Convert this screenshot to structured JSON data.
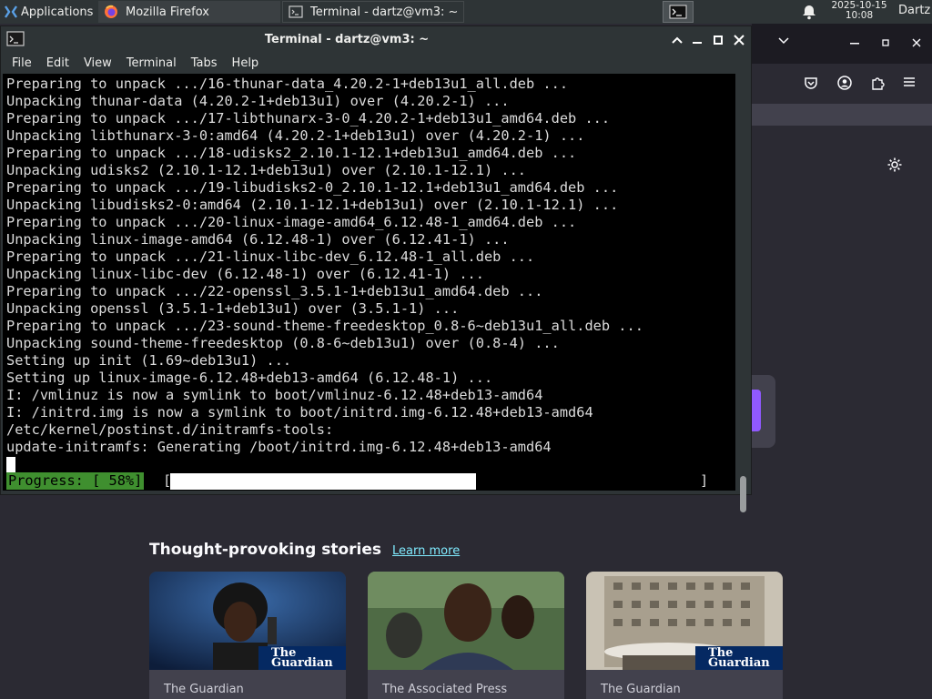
{
  "panel": {
    "applications_label": "Applications",
    "tasks": [
      {
        "title": "Mozilla Firefox"
      },
      {
        "title": "Terminal - dartz@vm3: ~"
      }
    ],
    "clock_date": "2025-10-15",
    "clock_time": "10:08",
    "user": "Dartz"
  },
  "terminal": {
    "title": "Terminal - dartz@vm3: ~",
    "menu": [
      "File",
      "Edit",
      "View",
      "Terminal",
      "Tabs",
      "Help"
    ],
    "lines": [
      "Preparing to unpack .../16-thunar-data_4.20.2-1+deb13u1_all.deb ...",
      "Unpacking thunar-data (4.20.2-1+deb13u1) over (4.20.2-1) ...",
      "Preparing to unpack .../17-libthunarx-3-0_4.20.2-1+deb13u1_amd64.deb ...",
      "Unpacking libthunarx-3-0:amd64 (4.20.2-1+deb13u1) over (4.20.2-1) ...",
      "Preparing to unpack .../18-udisks2_2.10.1-12.1+deb13u1_amd64.deb ...",
      "Unpacking udisks2 (2.10.1-12.1+deb13u1) over (2.10.1-12.1) ...",
      "Preparing to unpack .../19-libudisks2-0_2.10.1-12.1+deb13u1_amd64.deb ...",
      "Unpacking libudisks2-0:amd64 (2.10.1-12.1+deb13u1) over (2.10.1-12.1) ...",
      "Preparing to unpack .../20-linux-image-amd64_6.12.48-1_amd64.deb ...",
      "Unpacking linux-image-amd64 (6.12.48-1) over (6.12.41-1) ...",
      "Preparing to unpack .../21-linux-libc-dev_6.12.48-1_all.deb ...",
      "Unpacking linux-libc-dev (6.12.48-1) over (6.12.41-1) ...",
      "Preparing to unpack .../22-openssl_3.5.1-1+deb13u1_amd64.deb ...",
      "Unpacking openssl (3.5.1-1+deb13u1) over (3.5.1-1) ...",
      "Preparing to unpack .../23-sound-theme-freedesktop_0.8-6~deb13u1_all.deb ...",
      "Unpacking sound-theme-freedesktop (0.8-6~deb13u1) over (0.8-4) ...",
      "Setting up init (1.69~deb13u1) ...",
      "Setting up linux-image-6.12.48+deb13-amd64 (6.12.48-1) ...",
      "I: /vmlinuz is now a symlink to boot/vmlinuz-6.12.48+deb13-amd64",
      "I: /initrd.img is now a symlink to boot/initrd.img-6.12.48+deb13-amd64",
      "/etc/kernel/postinst.d/initramfs-tools:",
      "update-initramfs: Generating /boot/initrd.img-6.12.48+deb13-amd64"
    ],
    "progress_label": "Progress: [ 58%]",
    "progress_open": "[",
    "progress_close": "]",
    "progress_fraction": 0.58
  },
  "firefox": {
    "stories_title": "Thought-provoking stories",
    "learn_more": "Learn more",
    "cards": [
      {
        "source": "The Guardian",
        "badge_line1": "The",
        "badge_line2": "Guardian"
      },
      {
        "source": "The Associated Press"
      },
      {
        "source": "The Guardian",
        "badge_line1": "The",
        "badge_line2": "Guardian"
      }
    ]
  },
  "colors": {
    "terminal_bg": "#000000",
    "progress_green": "#3f8f2f",
    "firefox_bg": "#2b2a33",
    "link": "#80ebff",
    "guardian_blue": "#052962"
  }
}
